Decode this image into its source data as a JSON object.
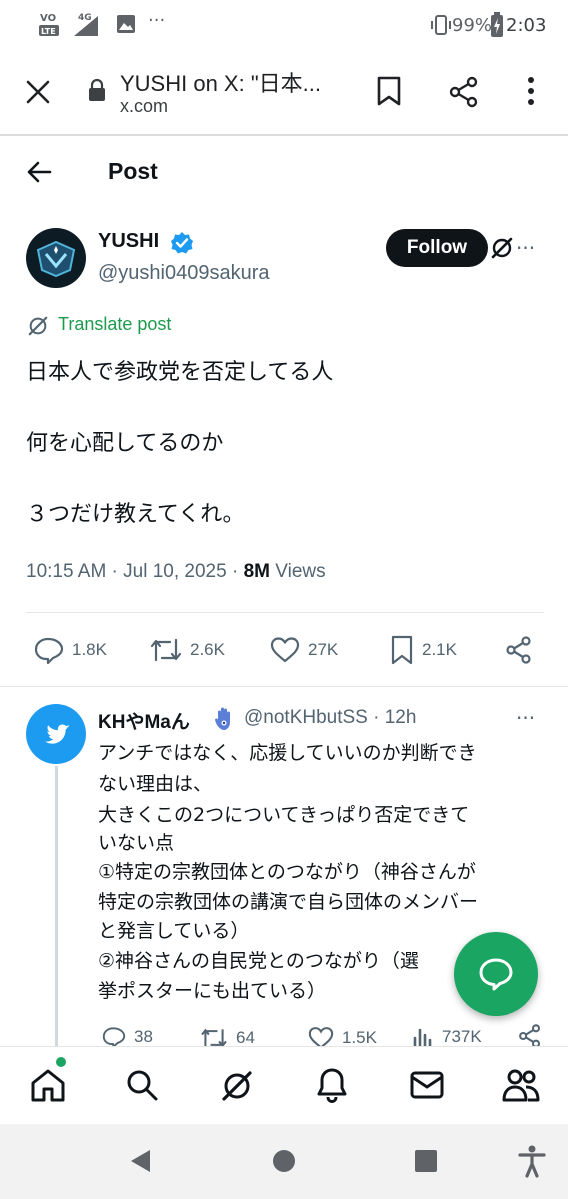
{
  "status_bar": {
    "network": "4G",
    "volte": "VoLTE",
    "more": "···",
    "battery": "99%",
    "time": "2:03"
  },
  "browser": {
    "tab_title": "YUSHI on X: \"日本...",
    "domain": "x.com",
    "icons": [
      "close-icon",
      "lock-icon",
      "bookmark-icon",
      "share-icon",
      "more-vert-icon"
    ]
  },
  "post_header": {
    "title": "Post",
    "back_icon": "arrow-left-icon"
  },
  "author": {
    "name": "YUSHI",
    "handle": "@yushi0409sakura",
    "verified": true,
    "follow_label": "Follow",
    "more": "···"
  },
  "translate_label": "Translate post",
  "tweet_lines": [
    "日本人で参政党を否定してる人",
    "何を心配してるのか",
    "３つだけ教えてくれ。"
  ],
  "meta": {
    "time": "10:15 AM · Jul 10, 2025 · ",
    "views_count": "8M",
    "views_label": "Views"
  },
  "actions": {
    "replies": "1.8K",
    "reposts": "2.6K",
    "likes": "27K",
    "bookmarks": "2.1K"
  },
  "reply": {
    "name": "KHやMaん",
    "handle": "@notKHbutSS · 12h",
    "more": "···",
    "lines": [
      "アンチではなく、応援していいのか判断でき",
      "ない理由は、",
      "大きくこの2つについてきっぱり否定できて",
      "いない点",
      "①特定の宗教団体とのつながり（神谷さんが",
      "特定の宗教団体の講演で自ら団体のメンバー",
      "と発言している）",
      "②神谷さんの自民党とのつながり（選",
      "挙ポスターにも出ている）"
    ],
    "replies": "38",
    "reposts": "64",
    "likes": "1.5K",
    "views": "737K"
  },
  "colors": {
    "accent_green": "#1ba562",
    "verified_blue": "#1d9bf0",
    "text_primary": "#0f1419",
    "text_secondary": "#536471"
  }
}
